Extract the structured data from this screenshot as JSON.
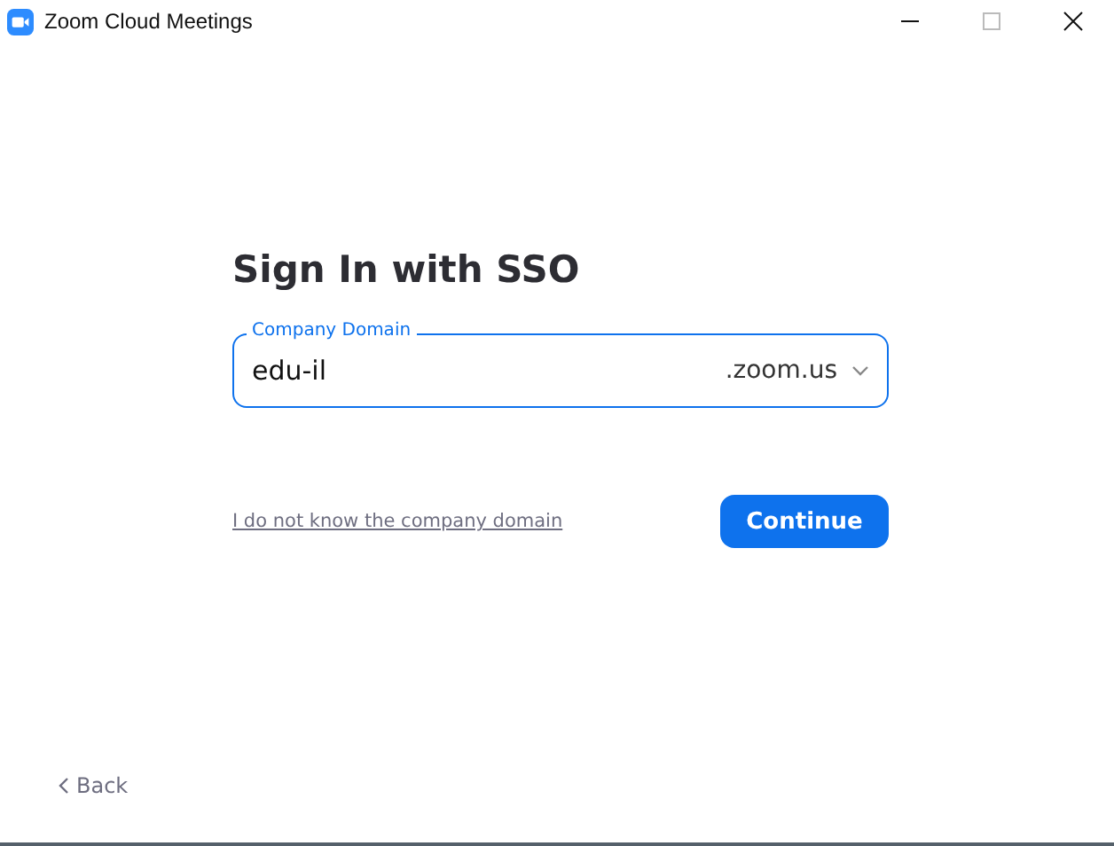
{
  "window": {
    "title": "Zoom Cloud Meetings"
  },
  "heading": "Sign In with SSO",
  "domain_field": {
    "label": "Company Domain",
    "value": "edu-il",
    "suffix": ".zoom.us",
    "focused": true
  },
  "help_link": "I do not know the company domain",
  "continue_button": "Continue",
  "back_link": "Back"
}
